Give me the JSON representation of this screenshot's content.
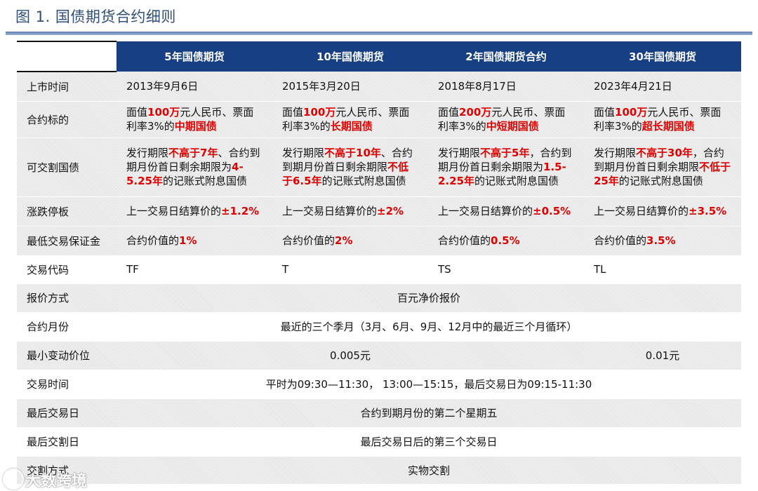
{
  "figure": {
    "title": "图 1. 国债期货合约细则"
  },
  "header": [
    "5年国债期货",
    "10年国债期货",
    "2年国债期货合约",
    "30年国债期货"
  ],
  "rows": {
    "listing": {
      "label": "上市时间",
      "cells": [
        "2013年9月6日",
        "2015年3月20日",
        "2018年8月17日",
        "2023年4月21日"
      ]
    },
    "underlying": {
      "label": "合约标的",
      "cells": [
        {
          "a": "面值",
          "b": "100万",
          "c": "元人民币、票面利率3%的",
          "d": "中期国债"
        },
        {
          "a": "面值",
          "b": "100万",
          "c": "元人民币、票面利率3%的",
          "d": "长期国债"
        },
        {
          "a": "面值",
          "b": "200万",
          "c": "元人民币、票面利率3%的",
          "d": "中短期国债"
        },
        {
          "a": "面值",
          "b": "100万",
          "c": "元人民币、票面利率3%的",
          "d": "超长期国债"
        }
      ]
    },
    "deliverable": {
      "label": "可交割国债",
      "cells": [
        {
          "a": "发行期限",
          "b": "不高于7年",
          "c": "、合约到期月份首日剩余期限为",
          "d": "4-5.25年",
          "e": "的记账式附息国债"
        },
        {
          "a": "发行期限",
          "b": "不高于10年",
          "c": "、合约到期月份首日剩余期限",
          "d": "不低于6.5年",
          "e": "的记账式附息国债"
        },
        {
          "a": "发行期限",
          "b": "不高于5年",
          "c": "，合约到期月份首日剩余期限为",
          "d": "1.5-2.25年",
          "e": "的记账式附息国债"
        },
        {
          "a": "发行期限",
          "b": "不高于30年",
          "c": "，合约到期月份首日剩余期限",
          "d": "不低于25年",
          "e": "的记账式附息国债"
        }
      ]
    },
    "limit": {
      "label": "涨跌停板",
      "prefix": "上一交易日结算价的",
      "values": [
        "±1.2%",
        "±2%",
        "±0.5%",
        "±3.5%"
      ]
    },
    "margin": {
      "label": "最低交易保证金",
      "prefix": "合约价值的",
      "values": [
        "1%",
        "2%",
        "0.5%",
        "3.5%"
      ]
    },
    "code": {
      "label": "交易代码",
      "cells": [
        "TF",
        "T",
        "TS",
        "TL"
      ]
    },
    "quote": {
      "label": "报价方式",
      "value": "百元净价报价"
    },
    "months": {
      "label": "合约月份",
      "value": "最近的三个季月（3月、6月、9月、12月中的最近三个月循环）"
    },
    "tick": {
      "label": "最小变动价位",
      "value_a": "0.005元",
      "value_b": "0.01元"
    },
    "hours": {
      "label": "交易时间",
      "value": "平时为09:30—11:30， 13:00—15:15，最后交易日为09:15-11:30"
    },
    "last_trade": {
      "label": "最后交易日",
      "value": "合约到期月份的第二个星期五"
    },
    "last_delivery": {
      "label": "最后交割日",
      "value": "最后交易日后的第三个交易日"
    },
    "delivery": {
      "label": "交割方式",
      "value": "实物交割"
    }
  },
  "watermark": "大数跨境"
}
